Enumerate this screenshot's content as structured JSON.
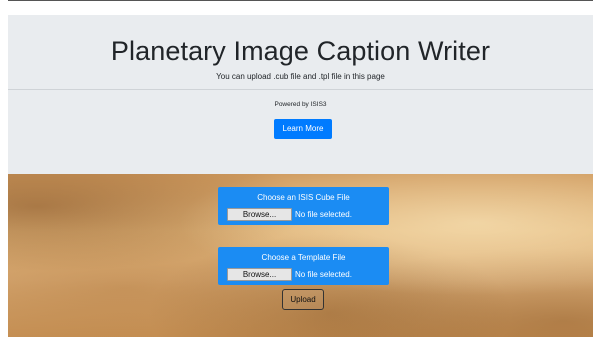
{
  "header": {
    "title": "Planetary Image Caption Writer",
    "subtitle": "You can upload .cub file and .tpl file in this page",
    "powered_by": "Powered by ISIS3",
    "learn_more_label": "Learn More"
  },
  "upload": {
    "cube": {
      "label": "Choose an ISIS Cube File",
      "browse_label": "Browse...",
      "status": "No file selected."
    },
    "template": {
      "label": "Choose a Template File",
      "browse_label": "Browse...",
      "status": "No file selected."
    },
    "submit_label": "Upload"
  },
  "colors": {
    "primary": "#007bff",
    "jumbotron_bg": "#e9ecef",
    "file_card": "#1b8cf3"
  }
}
